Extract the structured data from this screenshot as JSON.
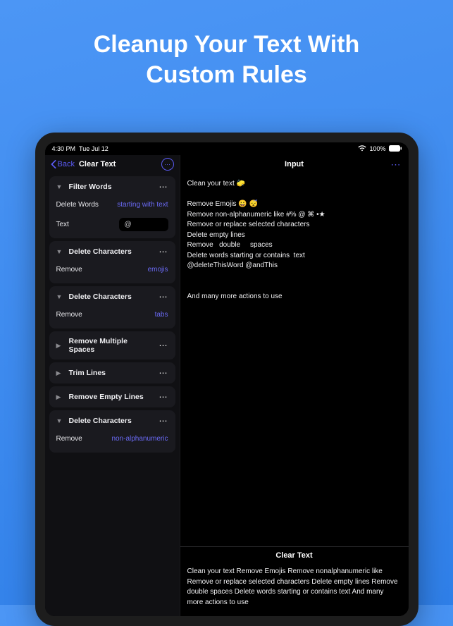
{
  "hero": {
    "line1": "Cleanup Your Text With",
    "line2": "Custom Rules"
  },
  "statusbar": {
    "time": "4:30 PM",
    "date": "Tue Jul 12",
    "wifi": "100%"
  },
  "left": {
    "back": "Back",
    "title": "Clear Text",
    "cards": [
      {
        "expanded": true,
        "title": "Filter Words",
        "rows": [
          {
            "key": "Delete Words",
            "val": "starting with text",
            "link": true
          },
          {
            "key": "Text",
            "val": "@",
            "input": true
          }
        ]
      },
      {
        "expanded": true,
        "title": "Delete Characters",
        "rows": [
          {
            "key": "Remove",
            "val": "emojis",
            "link": true
          }
        ]
      },
      {
        "expanded": true,
        "title": "Delete Characters",
        "rows": [
          {
            "key": "Remove",
            "val": "tabs",
            "link": true
          }
        ]
      },
      {
        "expanded": false,
        "title": "Remove Multiple Spaces",
        "rows": []
      },
      {
        "expanded": false,
        "title": "Trim Lines",
        "rows": []
      },
      {
        "expanded": false,
        "title": "Remove Empty Lines",
        "rows": []
      },
      {
        "expanded": true,
        "title": "Delete Characters",
        "rows": [
          {
            "key": "Remove",
            "val": "non-alphanumeric",
            "link": true
          }
        ]
      }
    ]
  },
  "right": {
    "input_title": "Input",
    "input_lines": [
      "Clean your text 🧽",
      "",
      "Remove Emojis 😀 😴",
      "Remove non-alphanumeric like #% @ ⌘ •★",
      "Remove or replace selected characters",
      "Delete empty lines",
      "Remove   double     spaces",
      "Delete words starting or contains  text",
      "@deleteThisWord @andThis",
      "",
      "",
      "And many more actions to use"
    ],
    "output_title": "Clear Text",
    "output_lines": [
      "Clean your text",
      "Remove Emojis",
      "Remove nonalphanumeric like",
      "Remove or replace selected characters",
      "Delete empty lines",
      "Remove double spaces",
      "Delete words starting or contains text",
      "And many more actions to use"
    ]
  }
}
